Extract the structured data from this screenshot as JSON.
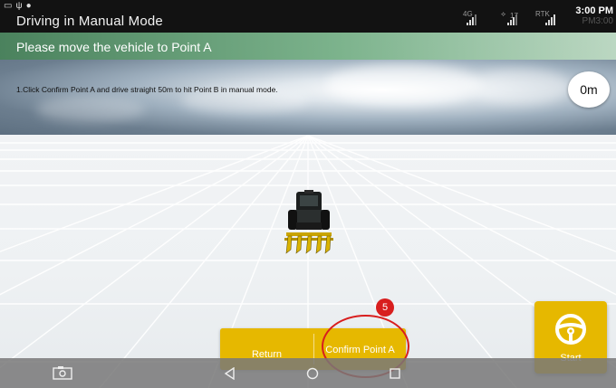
{
  "status_bar": {
    "app_title": "Driving in Manual Mode",
    "network_4g": "4G",
    "satellites": "17",
    "rtk_label": "RTK",
    "clock_primary": "3:00 PM",
    "clock_secondary": "PM3:00"
  },
  "banner": {
    "text": "Please move the vehicle to Point A"
  },
  "instruction": {
    "text": "1.Click Confirm Point A and drive straight 50m to hit Point B in manual mode."
  },
  "distance": {
    "value": "0m"
  },
  "buttons": {
    "return_label": "Return",
    "confirm_label": "Confirm Point A",
    "start_label": "Start"
  },
  "annotation": {
    "badge": "5"
  },
  "colors": {
    "accent": "#e6b800",
    "annotation": "#d81e1e",
    "banner": "#4f9a6a"
  },
  "icons": [
    "camera-icon",
    "back-icon",
    "home-icon",
    "recents-icon",
    "steering-wheel-icon"
  ]
}
